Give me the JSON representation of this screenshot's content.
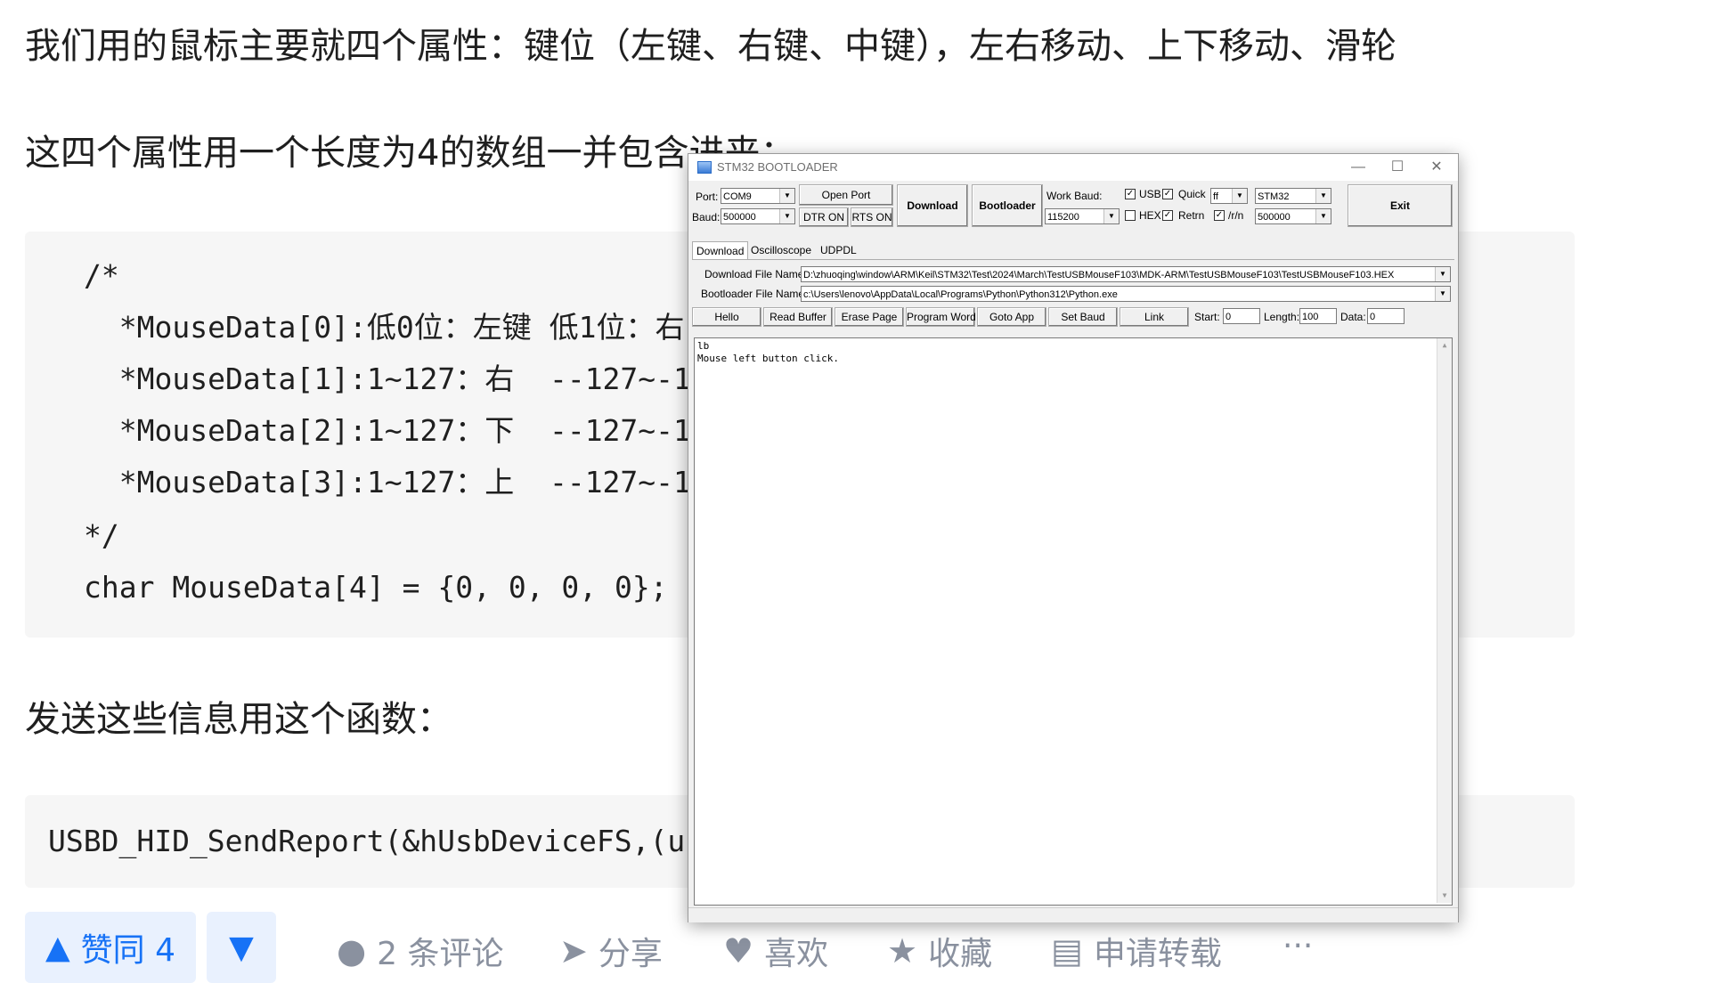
{
  "article": {
    "para1": "我们用的鼠标主要就四个属性：键位（左键、右键、中键），左右移动、上下移动、滑轮",
    "para2": "这四个属性用一个长度为4的数组一并包含进来：",
    "code1": [
      "/*",
      "  *MouseData[0]:低0位：左键 低1位：右",
      "  *MouseData[1]:1~127：右  --127~-1",
      "  *MouseData[2]:1~127：下  --127~-1",
      "  *MouseData[3]:1~127：上  --127~-1",
      "*/",
      "char MouseData[4] = {0, 0, 0, 0};"
    ],
    "para3": "发送这些信息用这个函数：",
    "code2": "USBD_HID_SendReport(&hUsbDeviceFS,(u"
  },
  "actions": {
    "upvote_label": "赞同 4",
    "comments_label": "2 条评论",
    "share_label": "分享",
    "like_label": "喜欢",
    "favorite_label": "收藏",
    "repost_label": "申请转载",
    "more_label": "···"
  },
  "window": {
    "title": "STM32 BOOTLOADER",
    "port_label": "Port:",
    "port_value": "COM9",
    "baud_label": "Baud:",
    "baud_value": "500000",
    "open_port": "Open Port",
    "dtr": "DTR ON",
    "rts": "RTS ON",
    "download_btn": "Download",
    "bootloader_btn": "Bootloader",
    "work_baud_label": "Work Baud:",
    "work_baud_value": "115200",
    "usb_label": "USB",
    "quick_label": "Quick",
    "quick_value": "ff",
    "hex_label": "HEX",
    "retrn_label": "Retrn",
    "rn_label": "/r/n",
    "chip_value": "STM32",
    "chip_baud_value": "500000",
    "exit_btn": "Exit",
    "tabs": [
      "Download",
      "Oscilloscope",
      "UDPDL"
    ],
    "download_file_label": "Download File Name:",
    "download_file_value": "D:\\zhuoqing\\window\\ARM\\Keil\\STM32\\Test\\2024\\March\\TestUSBMouseF103\\MDK-ARM\\TestUSBMouseF103\\TestUSBMouseF103.HEX",
    "bootloader_file_label": "Bootloader File Name:",
    "bootloader_file_value": "c:\\Users\\lenovo\\AppData\\Local\\Programs\\Python\\Python312\\Python.exe",
    "buttons": [
      "Hello",
      "Read Buffer",
      "Erase Page",
      "Program Word",
      "Goto App",
      "Set Baud",
      "Link"
    ],
    "start_label": "Start:",
    "start_value": "0",
    "length_label": "Length:",
    "length_value": "100",
    "data_label": "Data:",
    "data_value": "0",
    "console_lines": [
      "lb",
      "Mouse left button click."
    ],
    "checks": {
      "usb": true,
      "quick": true,
      "hex": false,
      "retrn": true,
      "rn": true
    }
  }
}
